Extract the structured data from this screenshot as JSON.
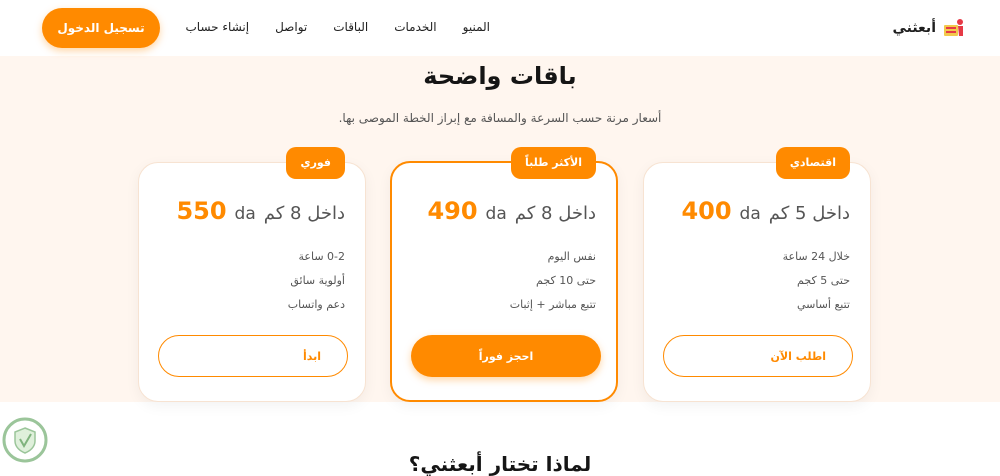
{
  "header": {
    "brand_name": "أبعثني",
    "nav": [
      "المنيو",
      "الخدمات",
      "الباقات",
      "تواصل",
      "إنشاء حساب"
    ],
    "login_label": "تسجيل الدخول"
  },
  "pricing": {
    "title": "باقات واضحة",
    "subtitle": "أسعار مرنة حسب السرعة والمسافة مع إبراز الخطة الموصى بها.",
    "plans": [
      {
        "badge": "اقتصادي",
        "price": "400",
        "currency": "da",
        "price_desc": "داخل 5 كم",
        "features": [
          "خلال 24 ساعة",
          "حتى 5 كجم",
          "تتبع أساسي"
        ],
        "cta": "اطلب الآن",
        "featured": false
      },
      {
        "badge": "الأكثر طلباً",
        "price": "490",
        "currency": "da",
        "price_desc": "داخل 8 كم",
        "features": [
          "نفس اليوم",
          "حتى 10 كجم",
          "تتبع مباشر + إثبات"
        ],
        "cta": "احجز فوراً",
        "featured": true
      },
      {
        "badge": "فوري",
        "price": "550",
        "currency": "da",
        "price_desc": "داخل 8 كم",
        "features": [
          "0-2 ساعة",
          "أولوية سائق",
          "دعم واتساب"
        ],
        "cta": "ابدأ",
        "featured": false
      }
    ]
  },
  "next_section_heading": "لماذا تختار أبعثني؟",
  "colors": {
    "accent": "#ff8a00",
    "section_bg": "#fff6ef",
    "text_dark": "#151515",
    "text_muted": "#555555"
  },
  "icons": {
    "brand": "delivery-logo-icon",
    "watermark": "shield-watermark-icon"
  }
}
